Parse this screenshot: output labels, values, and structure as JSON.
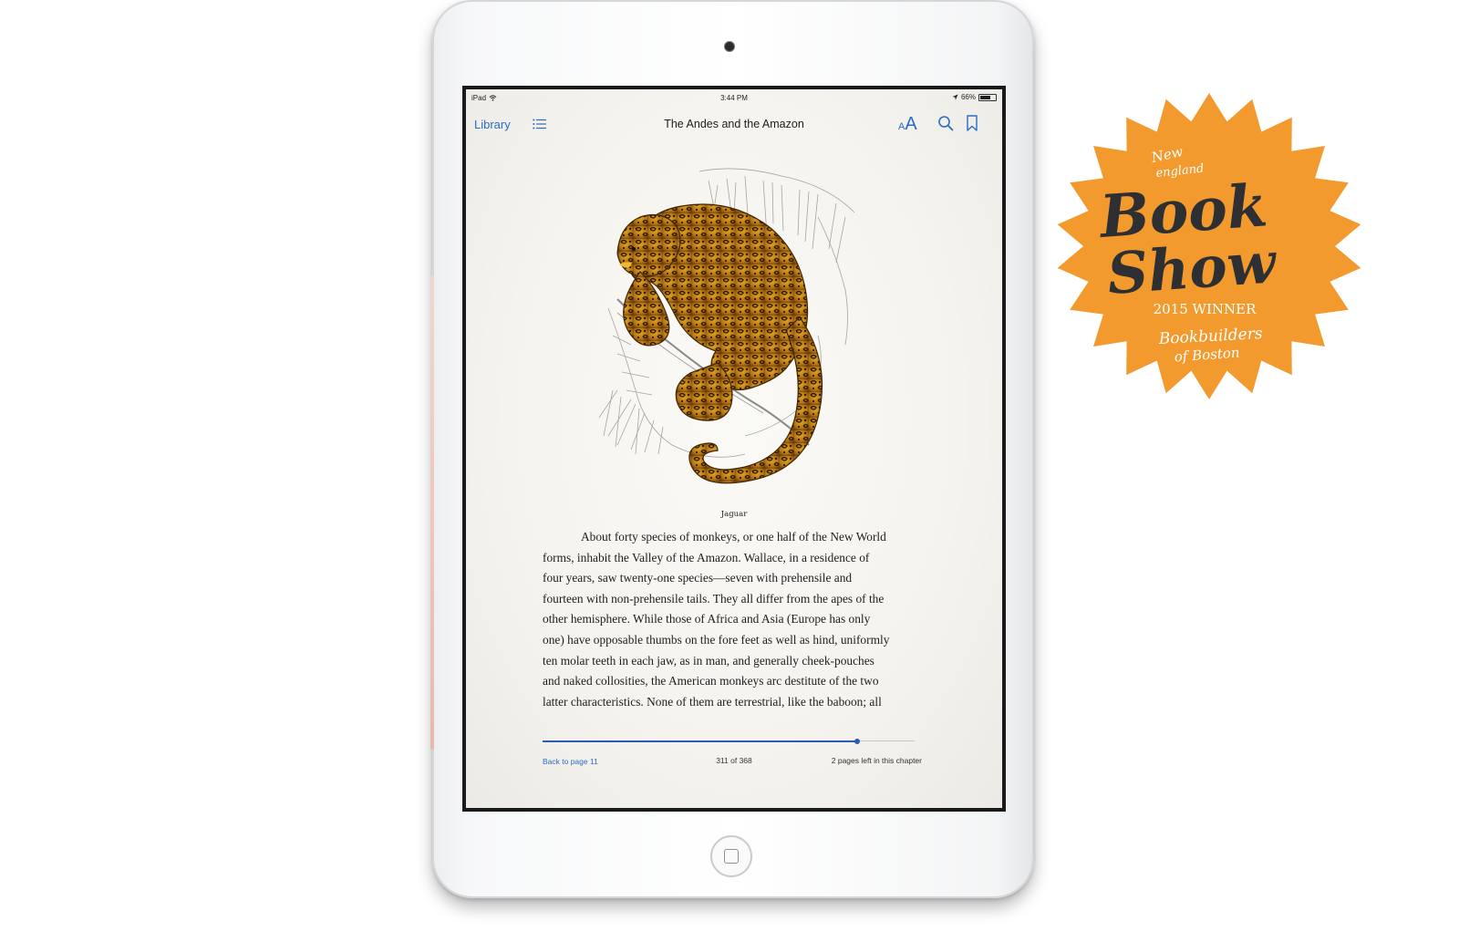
{
  "status_bar": {
    "device": "iPad",
    "time": "3:44 PM",
    "battery": "66%",
    "battery_level": 0.66
  },
  "nav_bar": {
    "library_label": "Library",
    "book_title": "The Andes and the Amazon",
    "font_button_label": "AA",
    "icons": [
      "table-of-contents-icon",
      "font-size-icon",
      "search-icon",
      "bookmark-icon"
    ]
  },
  "page": {
    "illustration": "jaguar-illustration",
    "caption": "Jaguar",
    "lines": [
      "About forty species of monkeys, or one half of the New World",
      "forms, inhabit the Valley of the Amazon. Wallace, in a residence of",
      "four years, saw twenty-one species—seven with prehensile and",
      "fourteen with non-prehensile tails. They all differ from the apes of the",
      "other hemisphere. While those of Africa and Asia (Europe has only",
      "one) have opposable thumbs on the fore feet as well as hind, uniformly",
      "ten molar teeth in each jaw, as in man, and generally cheek-pouches",
      "and naked collosities, the American monkeys arc destitute of the two",
      "latter characteristics. None of them are terrestrial, like the baboon; all"
    ]
  },
  "footer": {
    "back_link": "Back to page 11",
    "page_indicator": "311 of 368",
    "pages_left": "2 pages left in this chapter",
    "progress": 0.845
  },
  "award_badge": {
    "line1": "New",
    "line2": "england",
    "line3": "Book",
    "line4": "Show",
    "year": "2015 WINNER",
    "line5": "Bookbuilders",
    "line6": "of Boston",
    "color": "#f29a2e"
  },
  "colors": {
    "ios_blue": "#2b6cc4",
    "progress_blue": "#2b5bb4",
    "badge_orange": "#f29a2e",
    "badge_text": "#2e2f33"
  }
}
